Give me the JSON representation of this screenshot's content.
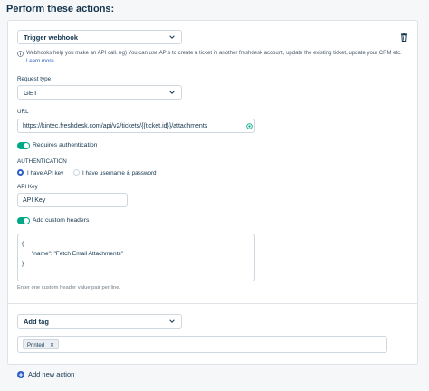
{
  "heading": "Perform these actions:",
  "action": {
    "type_selected": "Trigger webhook",
    "help_text": "Webhooks help you make an API call. eg) You can use APIs to create a ticket in another freshdesk account, update the existing ticket, update your CRM etc.",
    "learn_more": "Learn more",
    "request_type_label": "Request type",
    "request_type_value": "GET",
    "url_label": "URL",
    "url_value": "https://kintec.freshdesk.com/api/v2/tickets/{{ticket.id}}/attachments",
    "requires_auth_label": "Requires authentication",
    "requires_auth_on": true,
    "authentication_label": "AUTHENTICATION",
    "auth_option_1": "I have API key",
    "auth_option_2": "I have username & password",
    "api_key_label": "API Key",
    "api_key_value": "API Key",
    "custom_headers_label": "Add custom headers",
    "custom_headers_on": true,
    "headers_line1": "{",
    "headers_line2": "\"name\": \"Fetch Email Attachments\"",
    "headers_line3": "}",
    "headers_hint": "Enter one custom header value pair per line."
  },
  "tag_action": {
    "type_selected": "Add tag",
    "tags": [
      "Printed"
    ]
  },
  "add_new_action": "Add new action",
  "colors": {
    "accent": "#00a886",
    "link": "#2c5cc5",
    "text": "#12344d"
  }
}
